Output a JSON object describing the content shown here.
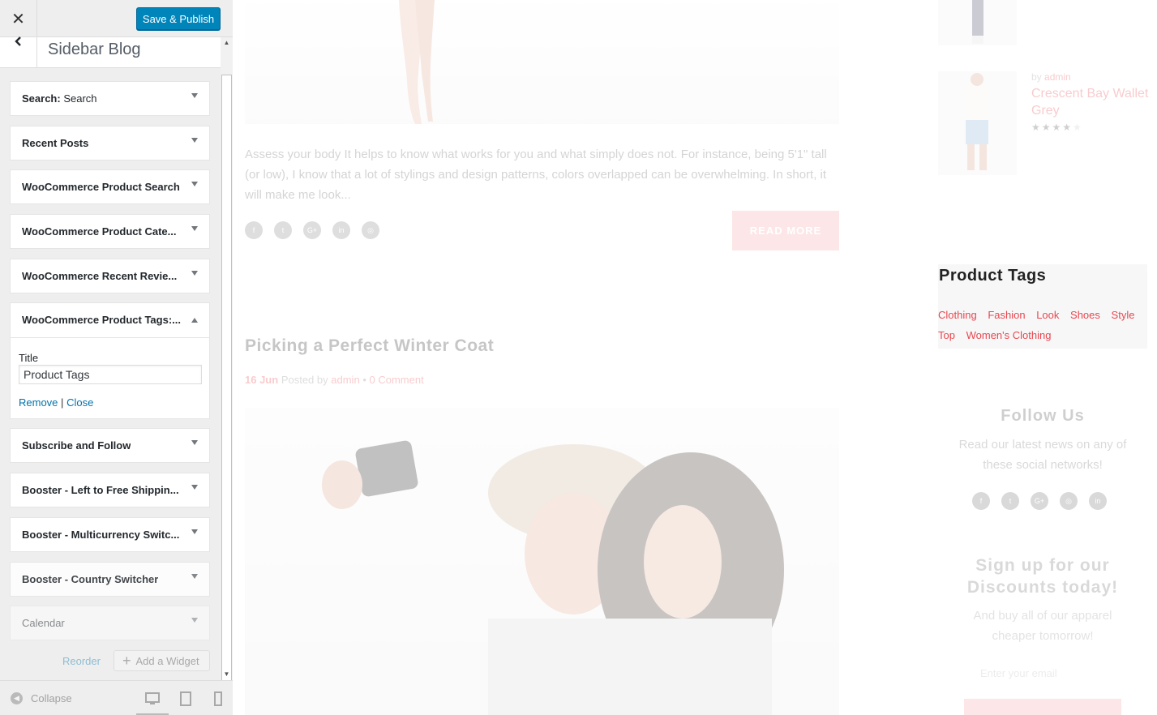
{
  "customizer": {
    "close_glyph": "✕",
    "save_label": "Save & Publish",
    "back_glyph": "‹",
    "section_title": "Sidebar Blog",
    "widgets_before": [
      {
        "title": "Search:",
        "instance_title": " Search"
      },
      {
        "title": "Recent Posts",
        "instance_title": ""
      },
      {
        "title": "WooCommerce Product Search",
        "instance_title": ""
      },
      {
        "title": "WooCommerce Product Cate...",
        "instance_title": ""
      },
      {
        "title": "WooCommerce Recent Revie...",
        "instance_title": ""
      }
    ],
    "open_widget": {
      "title": "WooCommerce Product Tags:...",
      "field_label": "Title",
      "field_value": "Product Tags",
      "remove_label": "Remove",
      "separator": "|",
      "close_label": "Close"
    },
    "widgets_after": [
      {
        "title": "Subscribe and Follow"
      },
      {
        "title": "Booster - Left to Free Shippin..."
      },
      {
        "title": "Booster - Multicurrency Switc..."
      },
      {
        "title": "Booster - Country Switcher"
      },
      {
        "title": "Calendar"
      }
    ],
    "reorder_label": "Reorder",
    "add_widget_label": "Add a Widget",
    "collapse_label": "Collapse",
    "icons": {
      "close": "close-icon",
      "back": "chevron-left-icon",
      "desktop": "desktop-icon",
      "tablet": "tablet-icon",
      "mobile": "mobile-icon"
    },
    "accent_color": "#0085ba"
  },
  "preview": {
    "excerpt": " Assess your body It helps to know what works for you and what simply does not. For instance, being 5'1\" tall (or low), I know that a lot of stylings and design patterns, colors overlapped can be overwhelming. In short, it will make me look...",
    "share_icons": [
      "f",
      "t",
      "G+",
      "in",
      "◎"
    ],
    "read_more": "READ MORE",
    "post_title": "Picking a Perfect Winter Coat",
    "post_date": "16 Jun",
    "posted_by": "Posted by",
    "post_author": "admin",
    "meta_sep": "•",
    "comments": "0 Comment",
    "product": {
      "by": "by",
      "author": "admin",
      "name": "Crescent Bay Wallet Grey",
      "stars": "★★★★",
      "empty_star": "★"
    },
    "tags_widget": {
      "title": "Product Tags",
      "tags": [
        "Clothing",
        "Fashion",
        "Look",
        "Shoes",
        "Style",
        "Top",
        "Women's Clothing"
      ]
    },
    "follow": {
      "title": "Follow Us",
      "text": "Read our latest news on any of these social networks!",
      "icons": [
        "f",
        "t",
        "G+",
        "◎",
        "in"
      ]
    },
    "signup": {
      "title": "Sign up for our Discounts today!",
      "text": "And buy all of our apparel cheaper tomorrow!",
      "email_placeholder": "Enter your email"
    },
    "accent_color": "#e8474f"
  }
}
